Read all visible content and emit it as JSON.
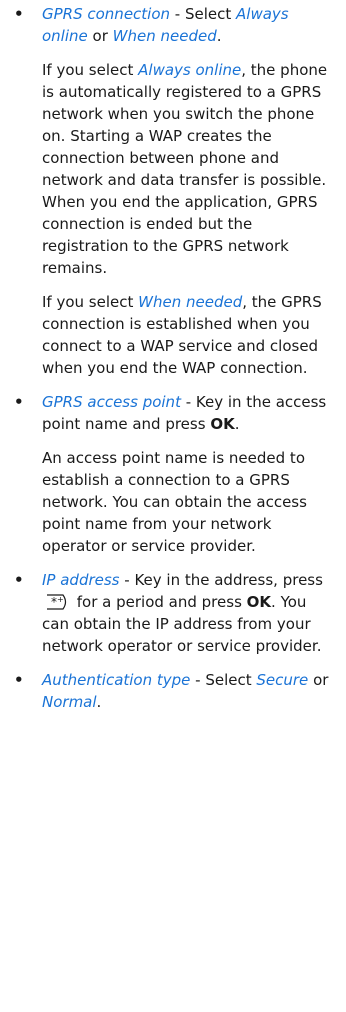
{
  "items": [
    {
      "bullet": "•",
      "term": "GPRS connection",
      "sep": " - Select ",
      "opt1": "Always online",
      "or": " or ",
      "opt2": "When needed",
      "end": ".",
      "sub1_pre": "If you select ",
      "sub1_term": "Always online",
      "sub1_post": ", the phone is automatically registered to a GPRS network when you switch the phone on. Starting a WAP creates the connection between phone and network and data transfer is possible. When you end the application, GPRS connection is ended but the registration to the GPRS network remains.",
      "sub2_pre": "If you select ",
      "sub2_term": "When needed",
      "sub2_post": ", the GPRS connection is established when you connect to a WAP service and closed when you end the WAP connection."
    },
    {
      "bullet": "•",
      "term": "GPRS access point",
      "sep": " - Key in the access point name and press ",
      "key": "OK",
      "end": ".",
      "sub1": "An access point name is needed to establish a connection to a GPRS network. You can obtain the access point name from your network operator or service provider."
    },
    {
      "bullet": "•",
      "term": "IP address",
      "sep": " - Key in the address, press ",
      "icon": "star-key-icon",
      "mid": " for a period and press ",
      "key": "OK",
      "post": ". You can obtain the IP address from your network operator or service provider."
    },
    {
      "bullet": "•",
      "term": "Authentication type",
      "sep": " - Select ",
      "opt1": "Secure",
      "or": " or ",
      "opt2": "Normal",
      "end": "."
    }
  ],
  "colors": {
    "link": "#1a73d6",
    "text": "#1a1a1a"
  }
}
